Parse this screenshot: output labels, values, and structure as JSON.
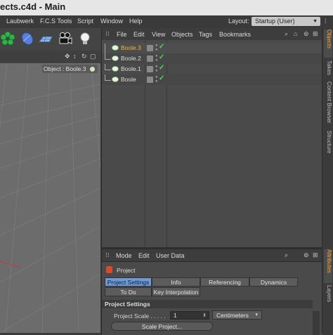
{
  "window": {
    "title": "ects.c4d - Main"
  },
  "menubar": {
    "items": [
      "Laubwerk",
      "F.C.S Tools",
      "Script",
      "Window",
      "Help"
    ],
    "layout_label": "Layout:",
    "layout_value": "Startup (User)"
  },
  "viewport": {
    "label": "Object : Boole.3"
  },
  "object_manager": {
    "menu": [
      "File",
      "Edit",
      "View",
      "Objects",
      "Tags",
      "Bookmarks"
    ],
    "objects": [
      {
        "name": "Boole.3",
        "selected": true
      },
      {
        "name": "Boole.2",
        "selected": false
      },
      {
        "name": "Boole.1",
        "selected": false
      },
      {
        "name": "Boole",
        "selected": false
      }
    ]
  },
  "attribute_manager": {
    "menu": [
      "Mode",
      "Edit",
      "User Data"
    ],
    "heading": "Project",
    "tabs_row1": [
      "Project Settings",
      "Info",
      "Referencing",
      "Dynamics"
    ],
    "tabs_row2": [
      "To Do",
      "Key Interpolation"
    ],
    "section_title": "Project Settings",
    "project_scale_label": "Project Scale . . . . .",
    "project_scale_value": "1",
    "project_scale_unit": "Centimeters",
    "scale_project_button": "Scale Project..."
  },
  "side_tabs_top": [
    "Objects",
    "Takes",
    "Content Browser",
    "Structure"
  ],
  "side_tabs_bottom": [
    "Attributes",
    "Layers"
  ],
  "colors": {
    "accent": "#f3a53a",
    "active_tab": "#6f9ad6",
    "check": "#4fd84f"
  }
}
